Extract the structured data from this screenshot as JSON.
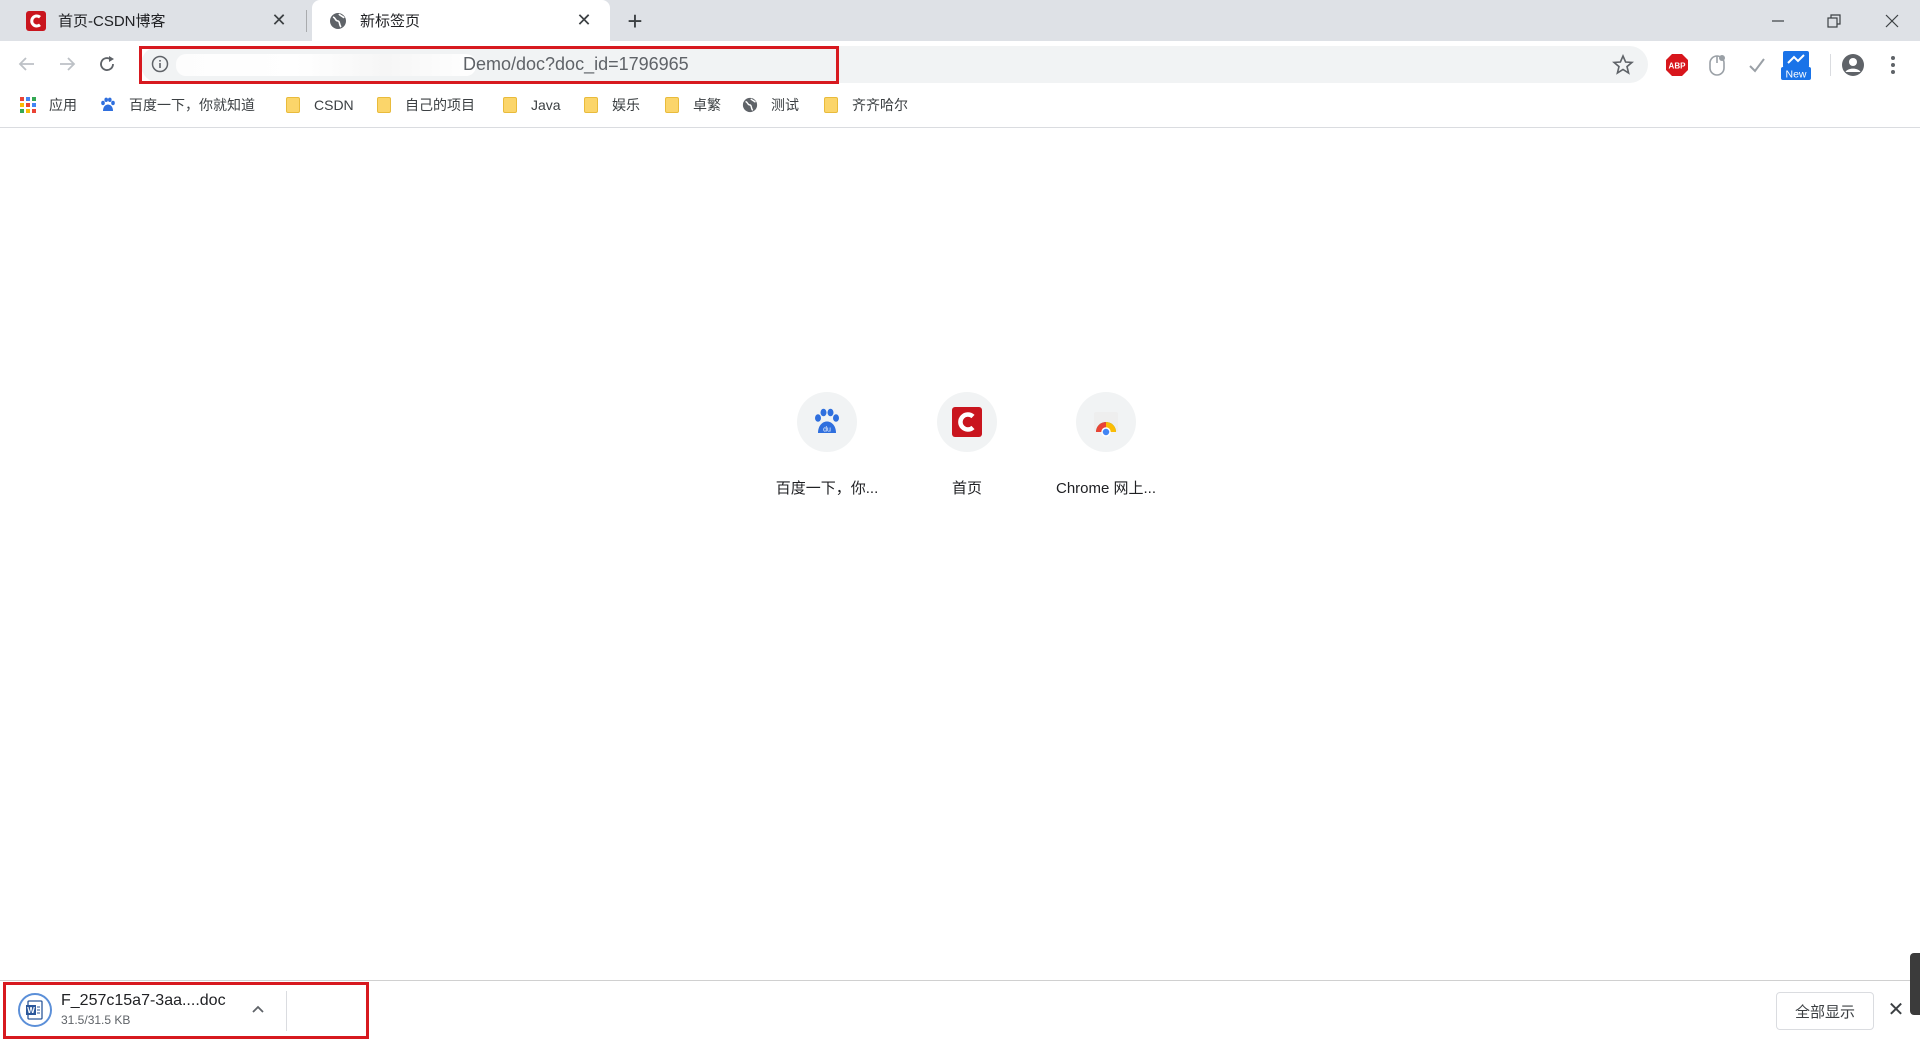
{
  "tabs": [
    {
      "title": "首页-CSDN博客",
      "favicon": "csdn-logo-icon",
      "active": false
    },
    {
      "title": "新标签页",
      "favicon": "globe-icon",
      "active": true
    }
  ],
  "toolbar": {
    "address": {
      "url_visible": "Demo/doc?doc_id=1796965"
    },
    "extensions": [
      "adblock-plus-icon",
      "mouse-extension-icon",
      "checkmark-extension-icon",
      "new-badge-extension-icon"
    ],
    "extension_badge_text": "New"
  },
  "bookmarks": [
    {
      "label": "应用",
      "icon": "apps-grid-icon"
    },
    {
      "label": "百度一下，你就知道",
      "icon": "baidu-paw-icon"
    },
    {
      "label": "CSDN",
      "icon": "folder-icon"
    },
    {
      "label": "自己的项目",
      "icon": "folder-icon"
    },
    {
      "label": "Java",
      "icon": "folder-icon"
    },
    {
      "label": "娱乐",
      "icon": "folder-icon"
    },
    {
      "label": "卓繁",
      "icon": "folder-icon"
    },
    {
      "label": "测试",
      "icon": "globe-icon"
    },
    {
      "label": "齐齐哈尔",
      "icon": "folder-icon"
    }
  ],
  "shortcuts": [
    {
      "label": "百度一下，你...",
      "icon": "baidu-paw-icon"
    },
    {
      "label": "首页",
      "icon": "csdn-logo-icon"
    },
    {
      "label": "Chrome 网上...",
      "icon": "chrome-webstore-icon"
    }
  ],
  "download": {
    "filename": "F_257c15a7-3aa....doc",
    "status": "31.5/31.5 KB",
    "show_all": "全部显示"
  },
  "colors": {
    "highlight": "#d7191f",
    "csdn_red": "#c9151e",
    "tabstrip": "#dee1e6"
  }
}
